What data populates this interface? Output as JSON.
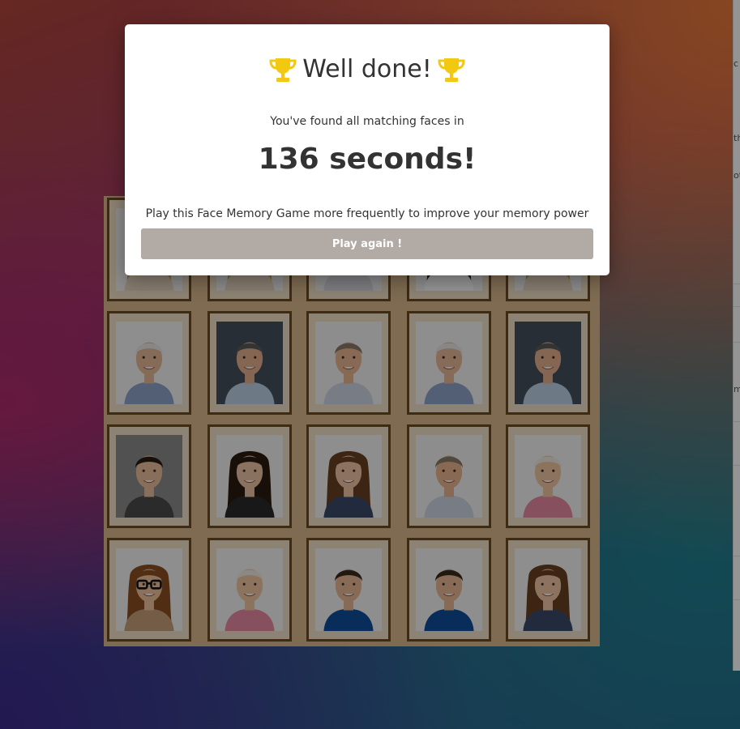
{
  "modal": {
    "title": "Well done!",
    "subtitle": "You've found all matching faces in",
    "time": "136 seconds!",
    "tip": "Play this Face Memory Game more frequently to improve your memory power",
    "button": "Play again !"
  },
  "right_panel": {
    "fragments": [
      "c",
      "th",
      "ot",
      "m"
    ]
  },
  "board": {
    "cards": [
      {
        "face": "woman-blonde"
      },
      {
        "face": "woman-blonde"
      },
      {
        "face": "man-middle-aged"
      },
      {
        "face": "woman-brunette"
      },
      {
        "face": "woman-blonde"
      },
      {
        "face": "old-man-white-hair"
      },
      {
        "face": "man-grey-hair-suit"
      },
      {
        "face": "man-smiling-grey"
      },
      {
        "face": "old-man-white-hair"
      },
      {
        "face": "man-grey-hair-suit"
      },
      {
        "face": "woman-dark-ponytail"
      },
      {
        "face": "woman-long-dark-hair"
      },
      {
        "face": "woman-long-brown-hair"
      },
      {
        "face": "man-smiling-grey"
      },
      {
        "face": "woman-short-blonde-laughing"
      },
      {
        "face": "woman-glasses-curly"
      },
      {
        "face": "woman-short-blonde-laughing"
      },
      {
        "face": "young-man-blue-polo"
      },
      {
        "face": "young-man-blue-polo"
      },
      {
        "face": "woman-long-brown-hair"
      }
    ]
  },
  "colors": {
    "button": "#b1aaa5",
    "trophy": "#f2c811",
    "card_border": "#6b4a24",
    "card_mat": "#f3e2c9"
  }
}
